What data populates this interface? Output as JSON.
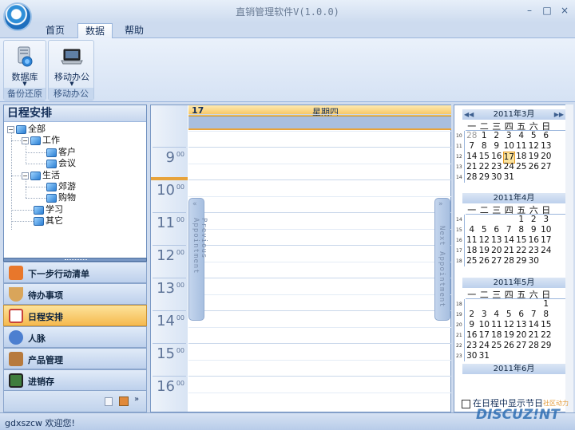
{
  "window": {
    "title": "直销管理软件V(1.0.0)",
    "min": "–",
    "max": "□",
    "close": "×"
  },
  "tabs": [
    "首页",
    "数据",
    "帮助"
  ],
  "ribbon": {
    "groups": [
      {
        "label": "备份还原",
        "buttons": [
          {
            "label": "数据库"
          }
        ]
      },
      {
        "label": "移动办公",
        "buttons": [
          {
            "label": "移动办公"
          }
        ]
      }
    ]
  },
  "left_panel": {
    "title": "日程安排",
    "tree": [
      {
        "label": "全部",
        "level": 0,
        "expand": "−"
      },
      {
        "label": "工作",
        "level": 1,
        "expand": "−"
      },
      {
        "label": "客户",
        "level": 2
      },
      {
        "label": "会议",
        "level": 2
      },
      {
        "label": "生活",
        "level": 1,
        "expand": "−"
      },
      {
        "label": "郊游",
        "level": 2
      },
      {
        "label": "购物",
        "level": 2
      },
      {
        "label": "学习",
        "level": 1
      },
      {
        "label": "其它",
        "level": 1
      }
    ]
  },
  "nav": [
    {
      "label": "下一步行动清单",
      "icon": "rss-icon",
      "color": "#e8772b"
    },
    {
      "label": "待办事项",
      "icon": "bowl-icon",
      "color": "#d9a55a"
    },
    {
      "label": "日程安排",
      "icon": "calendar-icon",
      "color": "#c8433a",
      "active": true
    },
    {
      "label": "人脉",
      "icon": "people-icon",
      "color": "#4c7fd0"
    },
    {
      "label": "产品管理",
      "icon": "box-icon",
      "color": "#b77a3d"
    },
    {
      "label": "进销存",
      "icon": "terminal-icon",
      "color": "#3f7d3d"
    }
  ],
  "nav_footer_icons": [
    "note-icon",
    "export-icon",
    "more-icon"
  ],
  "status": {
    "text": "gdxszcw 欢迎您!"
  },
  "day_view": {
    "day": "17",
    "weekday": "星期四",
    "hours": [
      {
        "h": "9",
        "m": "00"
      },
      {
        "h": "10",
        "m": "00"
      },
      {
        "h": "11",
        "m": "00"
      },
      {
        "h": "12",
        "m": "00"
      },
      {
        "h": "13",
        "m": "00"
      },
      {
        "h": "14",
        "m": "00"
      },
      {
        "h": "15",
        "m": "00"
      },
      {
        "h": "16",
        "m": "00"
      }
    ],
    "prev_label": "Previous Appointment",
    "next_label": "Next Appointment"
  },
  "mini_calendars": {
    "weekdays": [
      "一",
      "二",
      "三",
      "四",
      "五",
      "六",
      "日"
    ],
    "prev_nav": "◀◀",
    "next_nav": "▶▶",
    "months": [
      {
        "title": "2011年3月",
        "weeks": [
          {
            "wn": "10",
            "days": [
              "28",
              "1",
              "2",
              "3",
              "4",
              "5",
              "6"
            ]
          },
          {
            "wn": "11",
            "days": [
              "7",
              "8",
              "9",
              "10",
              "11",
              "12",
              "13"
            ]
          },
          {
            "wn": "12",
            "days": [
              "14",
              "15",
              "16",
              "17",
              "18",
              "19",
              "20"
            ]
          },
          {
            "wn": "13",
            "days": [
              "21",
              "22",
              "23",
              "24",
              "25",
              "26",
              "27"
            ]
          },
          {
            "wn": "14",
            "days": [
              "28",
              "29",
              "30",
              "31",
              "",
              "",
              ""
            ]
          }
        ],
        "today": "17"
      },
      {
        "title": "2011年4月",
        "weeks": [
          {
            "wn": "14",
            "days": [
              "",
              "",
              "",
              "",
              "1",
              "2",
              "3"
            ]
          },
          {
            "wn": "15",
            "days": [
              "4",
              "5",
              "6",
              "7",
              "8",
              "9",
              "10"
            ]
          },
          {
            "wn": "16",
            "days": [
              "11",
              "12",
              "13",
              "14",
              "15",
              "16",
              "17"
            ]
          },
          {
            "wn": "17",
            "days": [
              "18",
              "19",
              "20",
              "21",
              "22",
              "23",
              "24"
            ]
          },
          {
            "wn": "18",
            "days": [
              "25",
              "26",
              "27",
              "28",
              "29",
              "30",
              ""
            ]
          }
        ]
      },
      {
        "title": "2011年5月",
        "weeks": [
          {
            "wn": "18",
            "days": [
              "",
              "",
              "",
              "",
              "",
              "",
              "1"
            ]
          },
          {
            "wn": "19",
            "days": [
              "2",
              "3",
              "4",
              "5",
              "6",
              "7",
              "8"
            ]
          },
          {
            "wn": "20",
            "days": [
              "9",
              "10",
              "11",
              "12",
              "13",
              "14",
              "15"
            ]
          },
          {
            "wn": "21",
            "days": [
              "16",
              "17",
              "18",
              "19",
              "20",
              "21",
              "22"
            ]
          },
          {
            "wn": "22",
            "days": [
              "23",
              "24",
              "25",
              "26",
              "27",
              "28",
              "29"
            ]
          },
          {
            "wn": "23",
            "days": [
              "30",
              "31",
              "",
              "",
              "",
              "",
              ""
            ]
          }
        ]
      },
      {
        "title": "2011年6月",
        "weeks": []
      }
    ],
    "holiday_label": "在日程中显示节日"
  },
  "watermark": {
    "main": "DISCUZ!NT",
    "sub": "社区动力"
  }
}
